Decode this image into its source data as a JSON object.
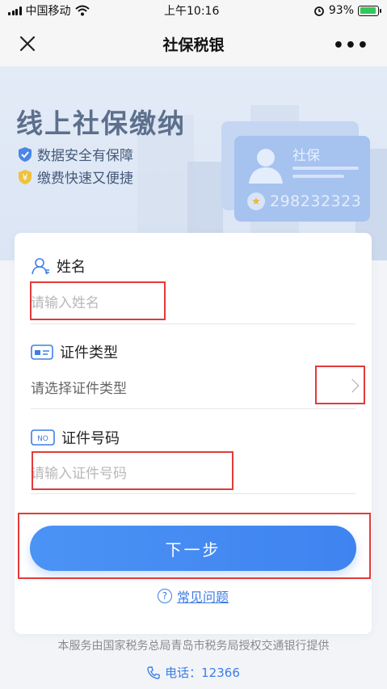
{
  "status_bar": {
    "carrier": "中国移动",
    "time": "上午10:16",
    "battery_percent": "93%",
    "battery_level": 0.93,
    "icons": [
      "signal-icon",
      "wifi-icon",
      "alarm-icon",
      "battery-icon"
    ]
  },
  "nav": {
    "title": "社保税银",
    "close_icon": "close-icon",
    "more_label": "•••"
  },
  "banner": {
    "title": "线上社保缴纳",
    "features": [
      "数据安全有保障",
      "缴费快速又便捷"
    ],
    "card_title": "社保",
    "card_number": "298232323",
    "icons": [
      "shield-check-icon",
      "yen-badge-icon",
      "avatar-icon",
      "star-badge-icon"
    ]
  },
  "form": {
    "name": {
      "label": "姓名",
      "placeholder": "请输入姓名",
      "icon": "user-icon"
    },
    "id_type": {
      "label": "证件类型",
      "placeholder": "请选择证件类型",
      "icon": "id-card-icon"
    },
    "id_number": {
      "label": "证件号码",
      "placeholder": "请输入证件号码",
      "icon": "no-badge-icon",
      "icon_text": "NO"
    },
    "next_button": "下一步",
    "faq_label": "常见问题",
    "faq_icon_text": "?"
  },
  "footer": {
    "note": "本服务由国家税务总局青岛市税务局授权交通银行提供",
    "phone": "电话：12366",
    "phone_icon": "phone-icon"
  },
  "colors": {
    "primary": "#4289f2",
    "highlight": "#e23a3a",
    "banner_bg": "#dfe8f5"
  }
}
